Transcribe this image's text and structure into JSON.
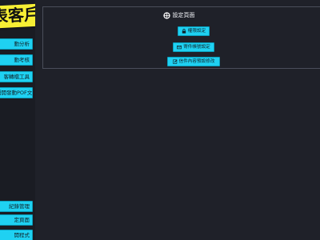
{
  "logo": {
    "text": "表客戶"
  },
  "sidebar": {
    "items": [
      {
        "label": "動分析"
      },
      {
        "label": "動考核"
      },
      {
        "label": "客轉檔工具"
      },
      {
        "label": "潛開發動POF文"
      },
      {
        "label": "紀錄管理"
      },
      {
        "label": "定頁面"
      },
      {
        "label": "開程式"
      }
    ]
  },
  "settings": {
    "title": "設定頁面",
    "buttons": [
      {
        "label": "權限設定",
        "icon": "lock-icon"
      },
      {
        "label": "寄件帳號設定",
        "icon": "mail-icon"
      },
      {
        "label": "信件內容預設修改",
        "icon": "edit-icon"
      }
    ]
  },
  "colors": {
    "background": "#1f2129",
    "sidebar": "#1a1c23",
    "accent": "#1fd1f2",
    "logo": "#f7ef34"
  }
}
